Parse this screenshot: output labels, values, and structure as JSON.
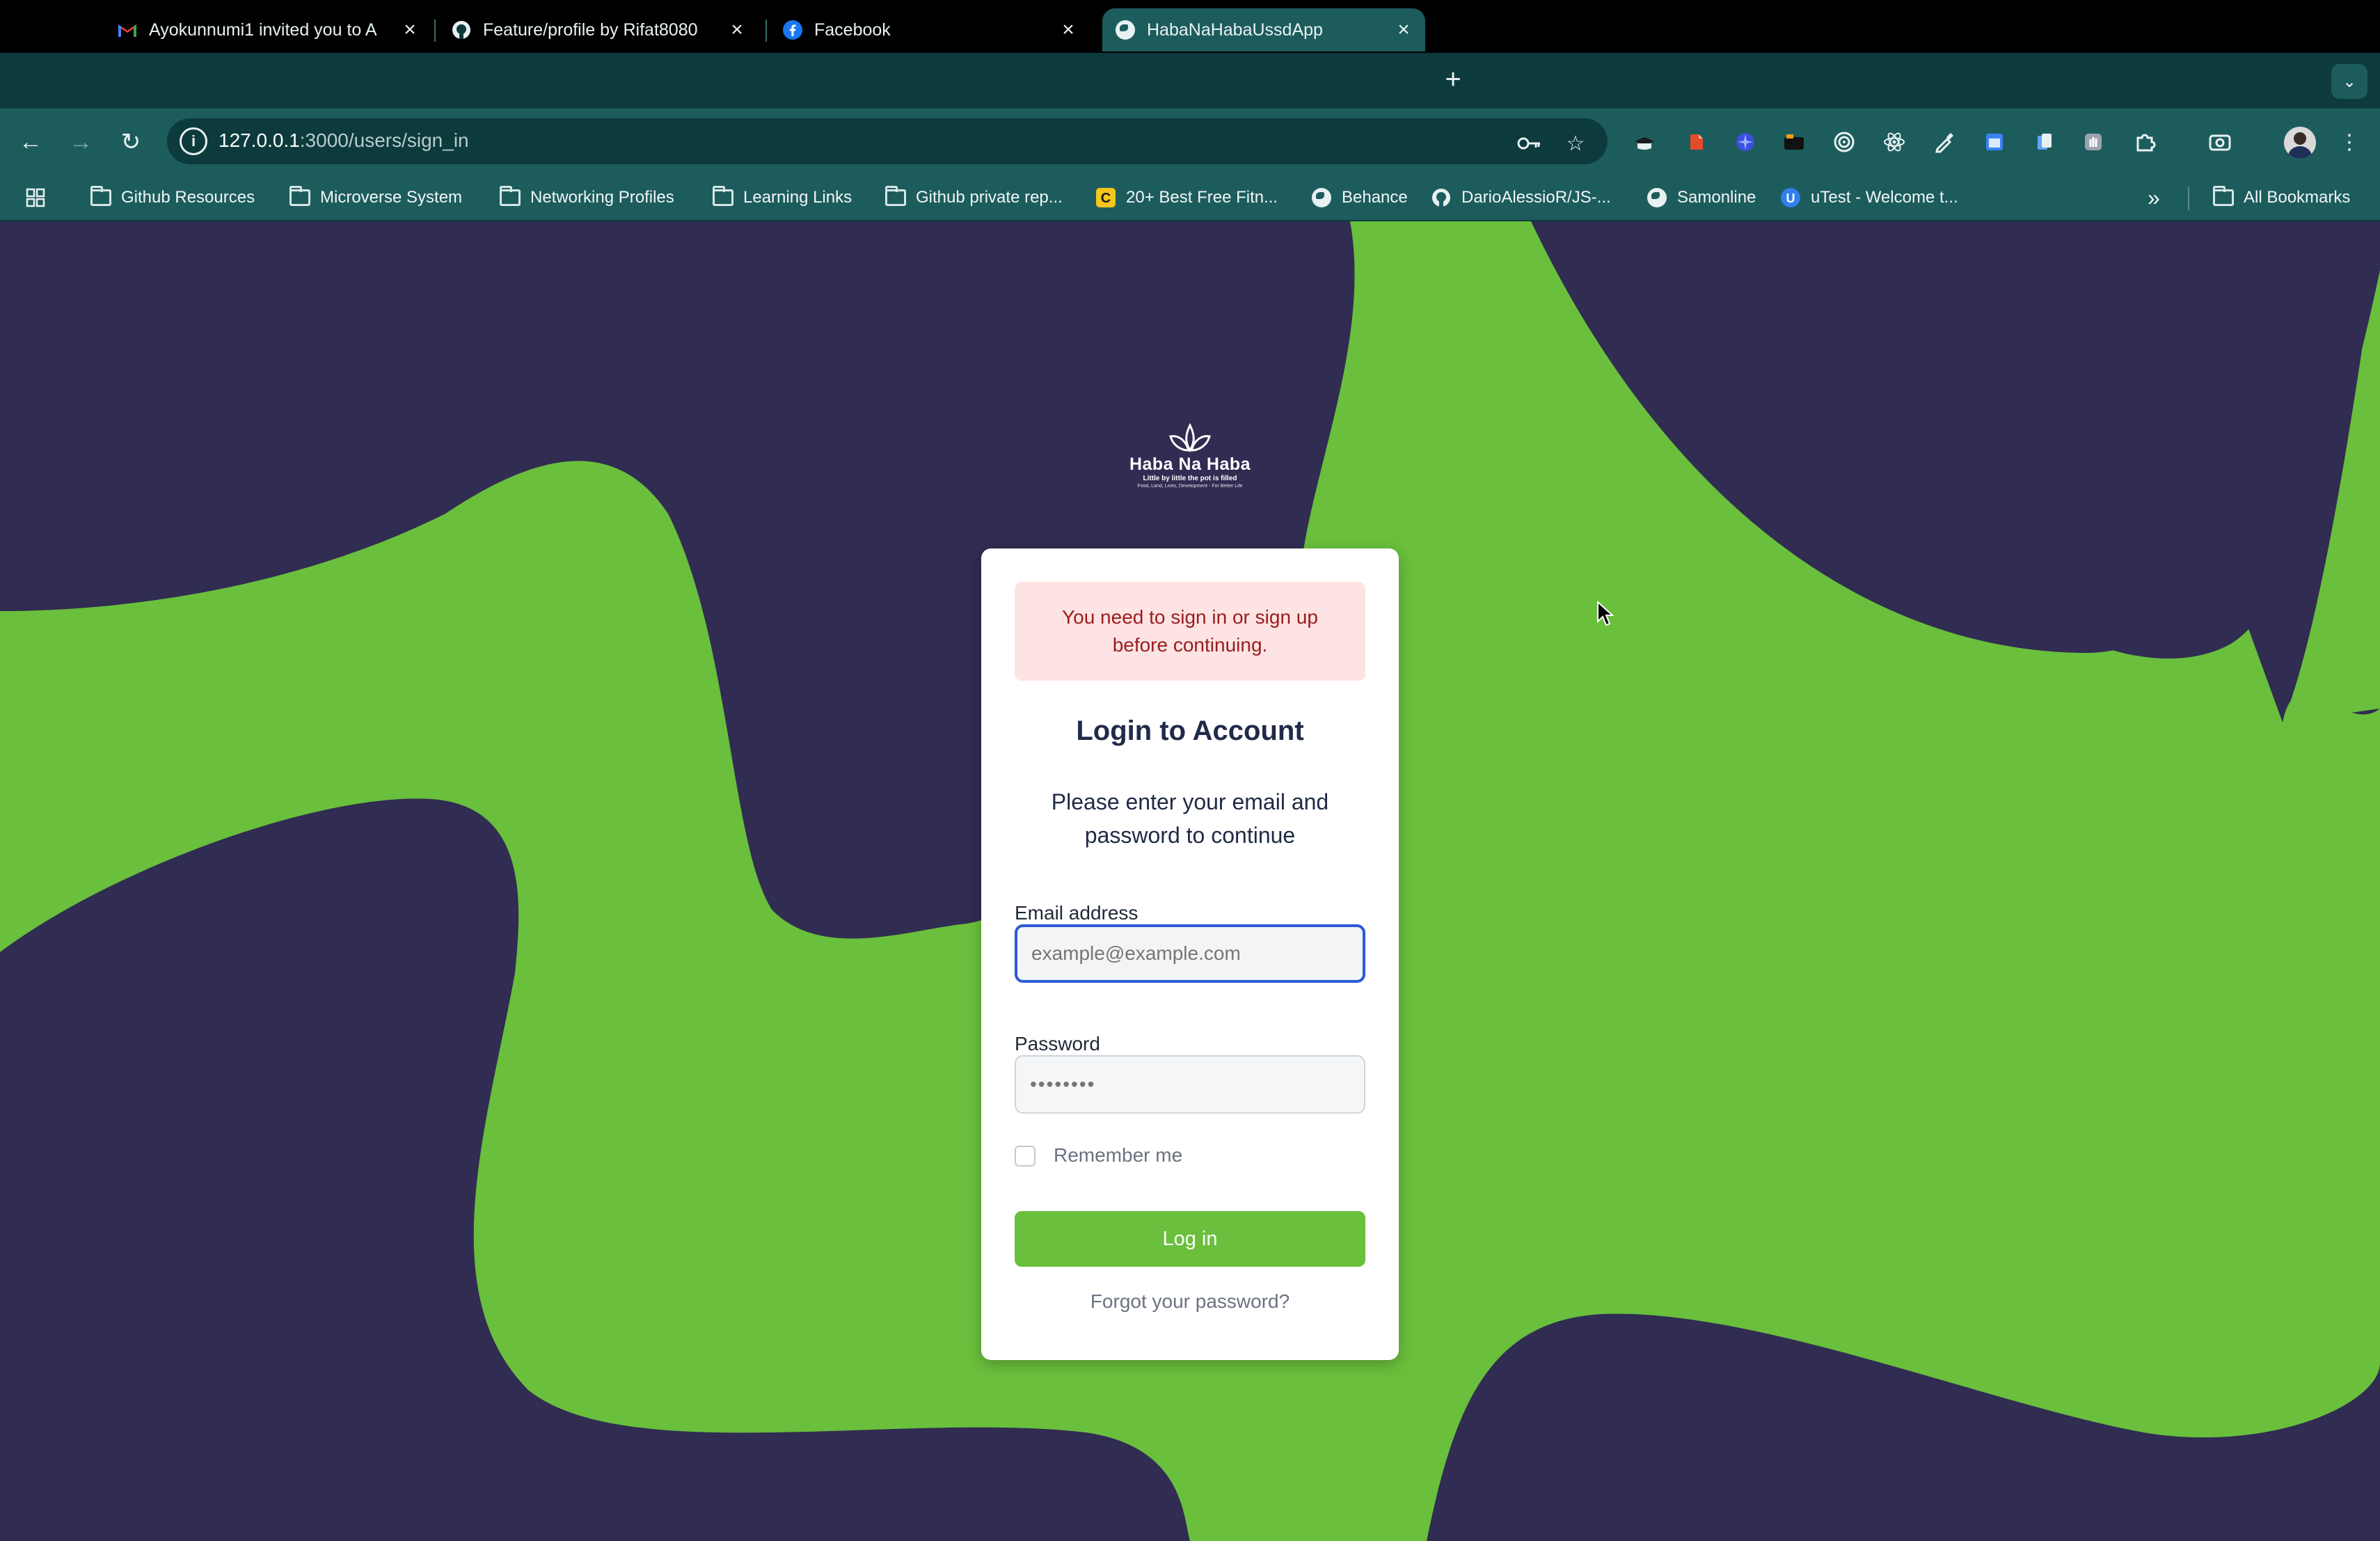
{
  "browser": {
    "tabs": [
      {
        "title": "Ayokunnumi1 invited you to A",
        "icon": "gmail-icon",
        "active": false
      },
      {
        "title": "Feature/profile by Rifat8080",
        "icon": "github-icon",
        "active": false
      },
      {
        "title": "Facebook",
        "icon": "facebook-icon",
        "active": false
      },
      {
        "title": "HabaNaHabaUssdApp",
        "icon": "globe-icon",
        "active": true
      }
    ],
    "new_tab_symbol": "+",
    "tab_search_symbol": "⌄",
    "close_symbol": "×",
    "address_bar": {
      "url_host": "127.0.0.1",
      "url_path": ":3000/users/sign_in"
    },
    "nav": {
      "back": "←",
      "forward": "→",
      "reload": "↻"
    },
    "bookmarks": [
      {
        "label": "Github Resources",
        "icon": "folder-icon"
      },
      {
        "label": "Microverse System",
        "icon": "folder-icon"
      },
      {
        "label": "Networking Profiles",
        "icon": "folder-icon"
      },
      {
        "label": "Learning Links",
        "icon": "folder-icon"
      },
      {
        "label": "Github private rep...",
        "icon": "folder-icon"
      },
      {
        "label": "20+ Best Free Fitn...",
        "icon": "c-icon"
      },
      {
        "label": "Behance",
        "icon": "globe-icon"
      },
      {
        "label": "DarioAlessioR/JS-...",
        "icon": "github-icon"
      },
      {
        "label": "Samonline",
        "icon": "globe-icon"
      },
      {
        "label": "uTest - Welcome t...",
        "icon": "utest-icon"
      }
    ],
    "more_bookmarks_symbol": "»",
    "all_bookmarks": "All Bookmarks"
  },
  "page": {
    "logo": {
      "brand": "Haba Na Haba",
      "tagline": "Little by little the pot is filled",
      "sub_tagline": "Food, Land, Lives, Development - For Better Life"
    },
    "alert": "You need to sign in or sign up before continuing.",
    "title": "Login to Account",
    "subtitle": "Please enter your email and password to continue",
    "email": {
      "label": "Email address",
      "placeholder": "example@example.com",
      "value": ""
    },
    "password": {
      "label": "Password",
      "placeholder": "••••••••",
      "value": ""
    },
    "remember_me": {
      "label": "Remember me",
      "checked": false
    },
    "login_button": "Log in",
    "forgot_link": "Forgot your password?"
  },
  "colors": {
    "background_navy": "#302c52",
    "background_green": "#6abf3c",
    "button_green": "#6abf3c",
    "alert_bg": "#fde3e3",
    "alert_text": "#9b1c1c",
    "chrome_dark": "#0d3b3d",
    "chrome_toolbar": "#1d5c5d"
  }
}
